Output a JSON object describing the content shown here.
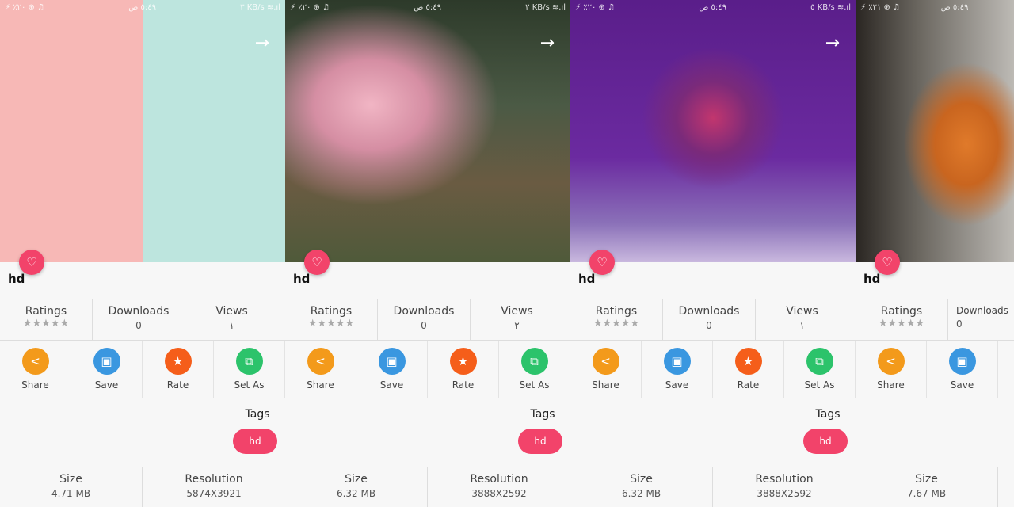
{
  "colors": {
    "accent": "#f2436a",
    "share": "#f39a1b",
    "save": "#3a97e0",
    "rate": "#f55e1a",
    "setas": "#2cc36b"
  },
  "labels": {
    "ratings": "Ratings",
    "downloads": "Downloads",
    "views": "Views",
    "share": "Share",
    "save": "Save",
    "rate": "Rate",
    "set_as": "Set As",
    "tags": "Tags",
    "size": "Size",
    "resolution": "Resolution",
    "stars": "★★★★★",
    "heart": "♡",
    "arrow": "→"
  },
  "panels": [
    {
      "status_left": "⚡ ٪٢٠ ⊕ ♫",
      "status_time": "٥:٤٩ ص",
      "status_right": "٣ KB/s ≋.ıl",
      "title": "hd",
      "views": "١",
      "downloads": "0",
      "tag": "hd",
      "size": "4.71 MB",
      "resolution": "5874X3921",
      "bg": "linear-gradient(90deg,#f7b8b6 0,#f7b8b6 50%,#bde5de 50%,#bde5de 100%)"
    },
    {
      "status_left": "⚡ ٪٢٠ ⊕ ♫",
      "status_time": "٥:٤٩ ص",
      "status_right": "٢ KB/s ≋.ıl",
      "title": "hd",
      "views": "٢",
      "downloads": "0",
      "tag": "hd",
      "size": "6.32 MB",
      "resolution": "3888X2592",
      "bg": "radial-gradient(ellipse at 30% 40%,#f1b5c4 0,#d58ea3 20%,transparent 45%),linear-gradient(180deg,#2d3a2a 0,#4b5a45 40%,#6a5b42 70%,#4f5a3a 100%)"
    },
    {
      "status_left": "⚡ ٪٢٠ ⊕ ♫",
      "status_time": "٥:٤٩ ص",
      "status_right": "٥ KB/s ≋.ıl",
      "title": "hd",
      "views": "١",
      "downloads": "0",
      "tag": "hd",
      "size": "6.32 MB",
      "resolution": "3888X2592",
      "bg": "radial-gradient(circle at 50% 45%,#c2366e 0,#7a2a7a 18%,transparent 35%),linear-gradient(180deg,#5a1e8a 0,#6b2aa0 60%,#8a70b8 85%,#c9b8de 100%)"
    },
    {
      "status_left": "⚡ ٪٢١ ⊕ ♫",
      "status_time": "٥:٤٩ ص",
      "status_right": "",
      "title": "hd",
      "views": "",
      "downloads": "0",
      "tag": "",
      "size": "7.67 MB",
      "resolution": "",
      "bg": "radial-gradient(ellipse at 70% 55%,#e07a2a 0,#c9651f 20%,transparent 40%),linear-gradient(90deg,#2a2622 0,#6b6760 40%,#bdbab5 100%)"
    }
  ]
}
